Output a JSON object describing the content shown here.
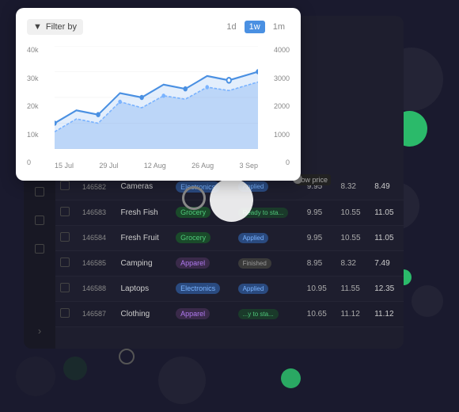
{
  "sidebar": {
    "icons": [
      {
        "name": "refresh-icon",
        "symbol": "↻"
      },
      {
        "name": "layers-icon",
        "symbol": "⊞"
      },
      {
        "name": "menu-icon",
        "symbol": "≡"
      },
      {
        "name": "checkbox1",
        "symbol": "☐"
      },
      {
        "name": "checkbox2",
        "symbol": "☐"
      },
      {
        "name": "checkbox3",
        "symbol": "☐"
      },
      {
        "name": "checkbox4",
        "symbol": "☐"
      },
      {
        "name": "checkbox5",
        "symbol": "☐"
      },
      {
        "name": "checkbox6",
        "symbol": "☐"
      },
      {
        "name": "arrow-icon",
        "symbol": "›"
      }
    ]
  },
  "chart": {
    "filter_label": "Filter by",
    "time_tabs": [
      "1d",
      "1w",
      "1m"
    ],
    "active_tab": "1w",
    "y_left": [
      "40k",
      "30k",
      "20k",
      "10k",
      "0"
    ],
    "y_right": [
      "4000",
      "3000",
      "2000",
      "1000",
      "0"
    ],
    "x_labels": [
      "15 Jul",
      "29 Jul",
      "12 Aug",
      "26 Aug",
      "3 Sep"
    ]
  },
  "table": {
    "rows": [
      {
        "id": "146582",
        "name": "Cameras",
        "category": "Electronics",
        "status": "Applied",
        "price1": "9.95",
        "price2": "8.32",
        "low_price": "8.49"
      },
      {
        "id": "146583",
        "name": "Fresh Fish",
        "category": "Grocery",
        "status": "Ready to sta...",
        "price1": "9.95",
        "price2": "10.55",
        "low_price": "11.05"
      },
      {
        "id": "146584",
        "name": "Fresh Fruit",
        "category": "Grocery",
        "status": "Applied",
        "price1": "9.95",
        "price2": "10.55",
        "low_price": "11.05"
      },
      {
        "id": "146585",
        "name": "Camping",
        "category": "Apparel",
        "status": "Finished",
        "price1": "8.95",
        "price2": "8.32",
        "low_price": "7.49"
      },
      {
        "id": "146588",
        "name": "Laptops",
        "category": "Electronics",
        "status": "Applied",
        "price1": "10.95",
        "price2": "11.55",
        "low_price": "12.35"
      },
      {
        "id": "146587",
        "name": "Clothing",
        "category": "Apparel",
        "status": "...y to sta...",
        "price1": "10.65",
        "price2": "11.12",
        "low_price": "11.12"
      }
    ]
  },
  "decorative": {
    "low_price": "low price",
    "prices_right": [
      "7.49",
      "7.49",
      "8.49",
      "8.49"
    ]
  },
  "colors": {
    "accent_green": "#2ecc71",
    "accent_blue": "#4a90e2",
    "dark_bg": "#1e1e2e",
    "sidebar_bg": "#181824"
  }
}
